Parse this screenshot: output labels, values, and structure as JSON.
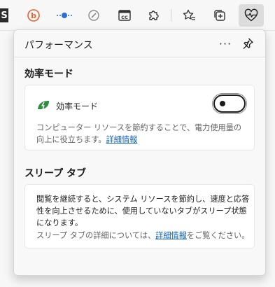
{
  "toolbar": {
    "s_tile": "S",
    "icons": [
      "bing-b-icon",
      "dotted-line-extension-icon",
      "compass-pen-icon",
      "cc-caption-icon",
      "puzzle-extensions-icon",
      "favorites-star-icon",
      "collections-icon",
      "heart-pulse-performance-icon"
    ]
  },
  "flyout": {
    "title": "パフォーマンス",
    "more": "···",
    "efficiency": {
      "section_title": "効率モード",
      "row_label": "効率モード",
      "toggle_on": false,
      "desc_main": "コンピューター リソースを節約することで、電力使用量の向上に役立ちます。",
      "desc_link": "詳細情報",
      "accent": "#2e8b3f"
    },
    "sleeping": {
      "section_title": "スリープ タブ",
      "desc_main": "閲覧を継続すると、システム リソースを節約し、速度と応答性を向上させるために、使用していないタブがスリープ状態になります。",
      "desc2_pre": "スリープ タブの詳細については、",
      "desc2_link": "詳細情報",
      "desc2_post": "をご覧ください。"
    }
  },
  "colors": {
    "link": "#0f5fb3",
    "active_toolbar_bg": "#dcdcdc",
    "bing_orange": "#e8612c",
    "extension_blue": "#2c6fd1"
  }
}
